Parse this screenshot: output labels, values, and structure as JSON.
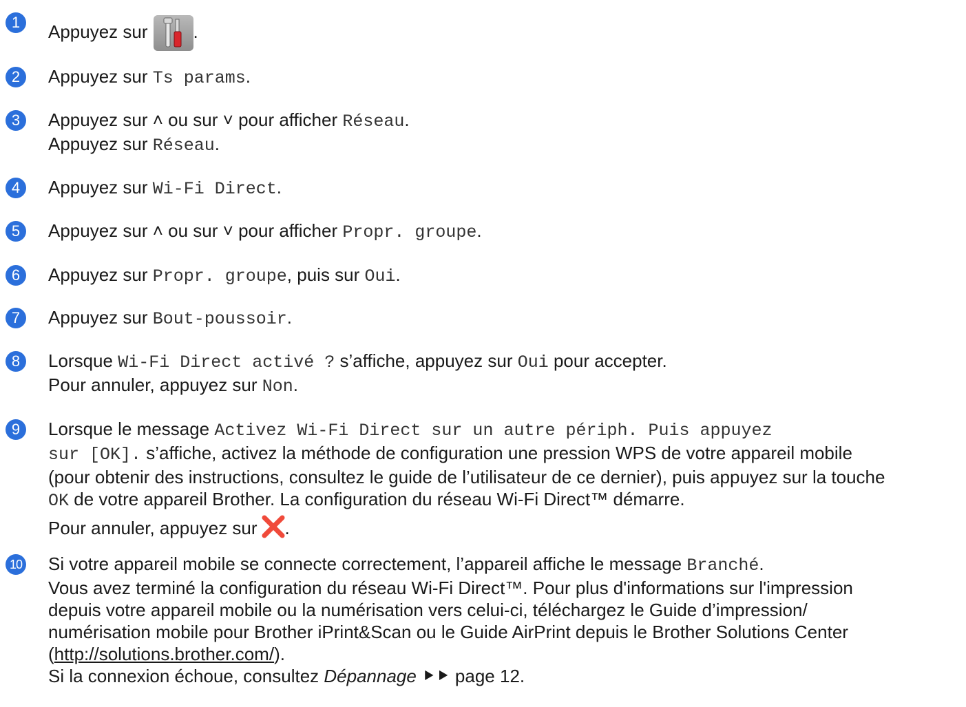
{
  "steps": [
    {
      "num": "1",
      "parts": [
        "Appuyez sur",
        "."
      ]
    },
    {
      "num": "2",
      "parts": [
        "Appuyez sur ",
        "Ts params",
        "."
      ]
    },
    {
      "num": "3",
      "line1": [
        "Appuyez sur ",
        " ou sur ",
        " pour afficher ",
        "Réseau",
        "."
      ],
      "line2": [
        "Appuyez sur ",
        "Réseau",
        "."
      ]
    },
    {
      "num": "4",
      "parts": [
        "Appuyez sur ",
        "Wi-Fi Direct",
        "."
      ]
    },
    {
      "num": "5",
      "parts": [
        "Appuyez sur ",
        " ou sur ",
        " pour afficher ",
        "Propr. groupe",
        "."
      ]
    },
    {
      "num": "6",
      "parts": [
        "Appuyez sur ",
        "Propr. groupe",
        ", puis sur ",
        "Oui",
        "."
      ]
    },
    {
      "num": "7",
      "parts": [
        "Appuyez sur ",
        "Bout-poussoir",
        "."
      ]
    },
    {
      "num": "8",
      "line1": [
        "Lorsque ",
        "Wi-Fi Direct activé ?",
        " s’affiche, appuyez sur ",
        "Oui",
        " pour accepter."
      ],
      "line2": [
        "Pour annuler, appuyez sur ",
        "Non",
        "."
      ]
    },
    {
      "num": "9",
      "l1": [
        "Lorsque le message ",
        "Activez Wi-Fi Direct sur un autre périph. Puis appuyez"
      ],
      "l2": [
        "sur [OK].",
        " s’affiche, activez la méthode de configuration une pression WPS de votre appareil mobile"
      ],
      "l3": "(pour obtenir des instructions, consultez le guide de l’utilisateur de ce dernier), puis appuyez sur la touche",
      "l4": [
        "OK",
        " de votre appareil Brother. La configuration du réseau Wi-Fi Direct™ démarre."
      ],
      "l5": [
        "Pour annuler, appuyez sur",
        "."
      ]
    },
    {
      "num": "10",
      "l1": [
        "Si votre appareil mobile se connecte correctement, l’appareil affiche le message ",
        "Branché",
        "."
      ],
      "l2": "Vous avez terminé la configuration du réseau Wi-Fi Direct™. Pour plus d'informations sur l'impression",
      "l3": "depuis votre appareil mobile ou la numérisation vers celui-ci, téléchargez le Guide d’impression/",
      "l4": "numérisation mobile pour Brother iPrint&Scan ou le Guide AirPrint depuis le Brother Solutions Center",
      "l5": [
        "(",
        "http://solutions.brother.com/",
        ")."
      ],
      "l6": [
        "Si la connexion échoue, consultez ",
        "Dépannage",
        " ",
        "page 12",
        "."
      ]
    }
  ],
  "icons": {
    "tools": "settings-tools-icon",
    "up": "chevron-up-icon",
    "down": "chevron-down-icon",
    "cancel": "cancel-x-icon",
    "xref": "double-arrow-icon"
  },
  "colors": {
    "step_badge": "#2b6fdb",
    "cancel_icon": "#f04a3a"
  }
}
